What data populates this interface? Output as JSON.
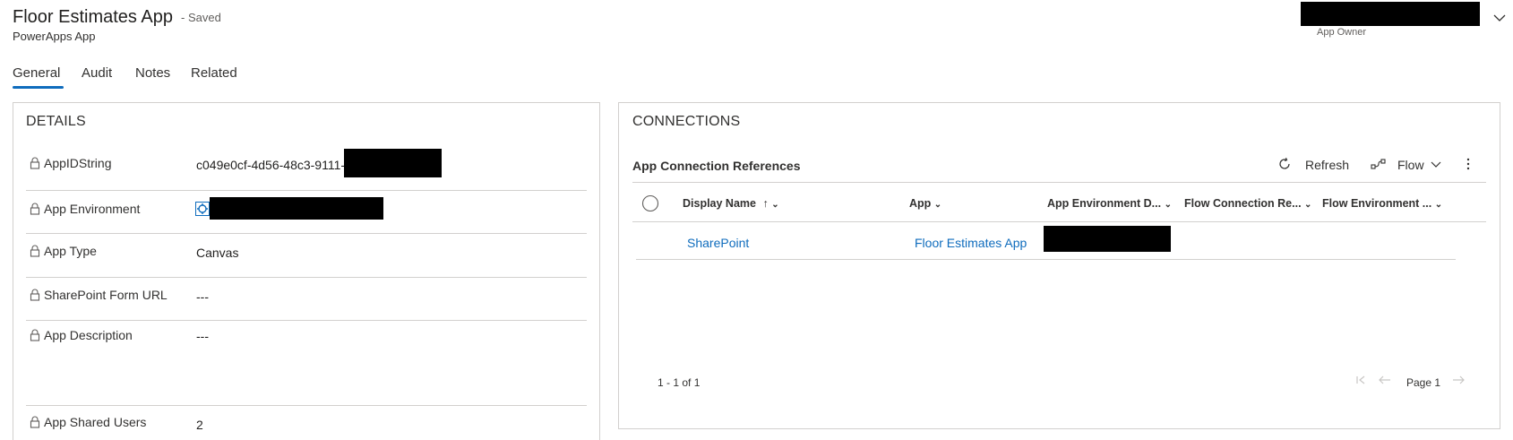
{
  "header": {
    "title": "Floor Estimates App",
    "save_status": "- Saved",
    "subtitle": "PowerApps App",
    "owner_label": "App Owner"
  },
  "tabs": [
    {
      "label": "General",
      "selected": true
    },
    {
      "label": "Audit",
      "selected": false
    },
    {
      "label": "Notes",
      "selected": false
    },
    {
      "label": "Related",
      "selected": false
    }
  ],
  "details": {
    "title": "DETAILS",
    "fields": [
      {
        "label": "AppIDString",
        "value": "c049e0cf-4d56-48c3-9111-"
      },
      {
        "label": "App Environment",
        "value": ""
      },
      {
        "label": "App Type",
        "value": "Canvas"
      },
      {
        "label": "SharePoint Form URL",
        "value": "---"
      },
      {
        "label": "App Description",
        "value": "---"
      },
      {
        "label": "App Shared Users",
        "value": "2"
      }
    ]
  },
  "connections": {
    "title": "CONNECTIONS",
    "subgrid_title": "App Connection References",
    "commands": {
      "refresh": "Refresh",
      "flow": "Flow"
    },
    "columns": [
      "Display Name",
      "App",
      "App Environment D...",
      "Flow Connection Re...",
      "Flow Environment ..."
    ],
    "rows": [
      {
        "display_name": "SharePoint",
        "app": "Floor Estimates App"
      }
    ],
    "footer": {
      "record_count": "1 - 1 of 1",
      "page": "Page 1"
    }
  },
  "colors": {
    "accent": "#0f6cbd",
    "border": "#d2d0ce",
    "text": "#323130"
  }
}
